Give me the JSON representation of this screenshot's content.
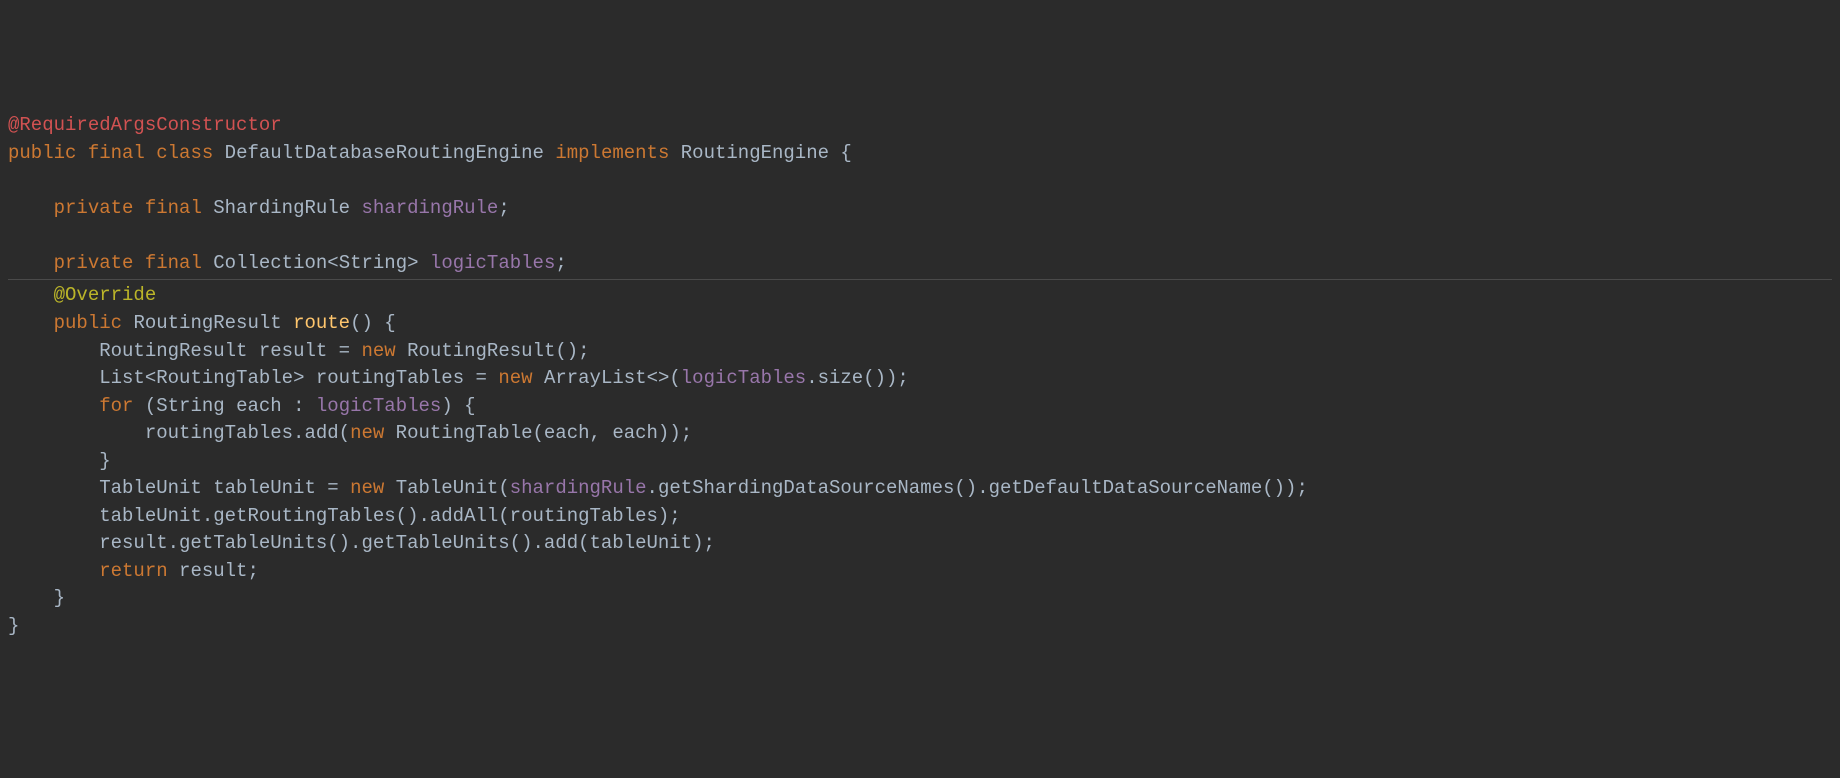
{
  "code": {
    "annotation_lombok": "@RequiredArgsConstructor",
    "line2": {
      "kw_public": "public",
      "kw_final": "final",
      "kw_class": "class",
      "classname": "DefaultDatabaseRoutingEngine",
      "kw_implements": "implements",
      "iface": "RoutingEngine",
      "brace": " {"
    },
    "line_field1": {
      "kw_private": "private",
      "kw_final": "final",
      "type": "ShardingRule",
      "name": "shardingRule",
      "semi": ";"
    },
    "line_field2": {
      "kw_private": "private",
      "kw_final": "final",
      "type_pre": "Collection<",
      "type_param": "String",
      "type_post": ">",
      "name": "logicTables",
      "semi": ";"
    },
    "override": "@Override",
    "method_sig": {
      "kw_public": "public",
      "ret": "RoutingResult",
      "name": "route",
      "parens": "()",
      "brace": " {"
    },
    "body_l1": {
      "type": "RoutingResult",
      "var": "result",
      "eq": " = ",
      "kw_new": "new",
      "ctor": " RoutingResult();"
    },
    "body_l2": {
      "type_pre": "List<",
      "type_param": "RoutingTable",
      "type_post": ">",
      "var": "routingTables",
      "eq": " = ",
      "kw_new": "new",
      "ctor_pre": " ArrayList<>(",
      "field": "logicTables",
      "ctor_post": ".size());"
    },
    "body_l3": {
      "kw_for": "for",
      "open": " (",
      "type": "String",
      "var": " each : ",
      "field": "logicTables",
      "close": ") {"
    },
    "body_l4": {
      "pre": "routingTables.add(",
      "kw_new": "new",
      "mid": " RoutingTable(each, each));"
    },
    "body_l5": "}",
    "body_l6": {
      "type": "TableUnit",
      "var": " tableUnit = ",
      "kw_new": "new",
      "mid": " TableUnit(",
      "field": "shardingRule",
      "post": ".getShardingDataSourceNames().getDefaultDataSourceName());"
    },
    "body_l7": "tableUnit.getRoutingTables().addAll(routingTables);",
    "body_l8": "result.getTableUnits().getTableUnits().add(tableUnit);",
    "body_l9": {
      "kw_return": "return",
      "rest": " result;"
    },
    "body_close": "}",
    "class_close": "}"
  }
}
